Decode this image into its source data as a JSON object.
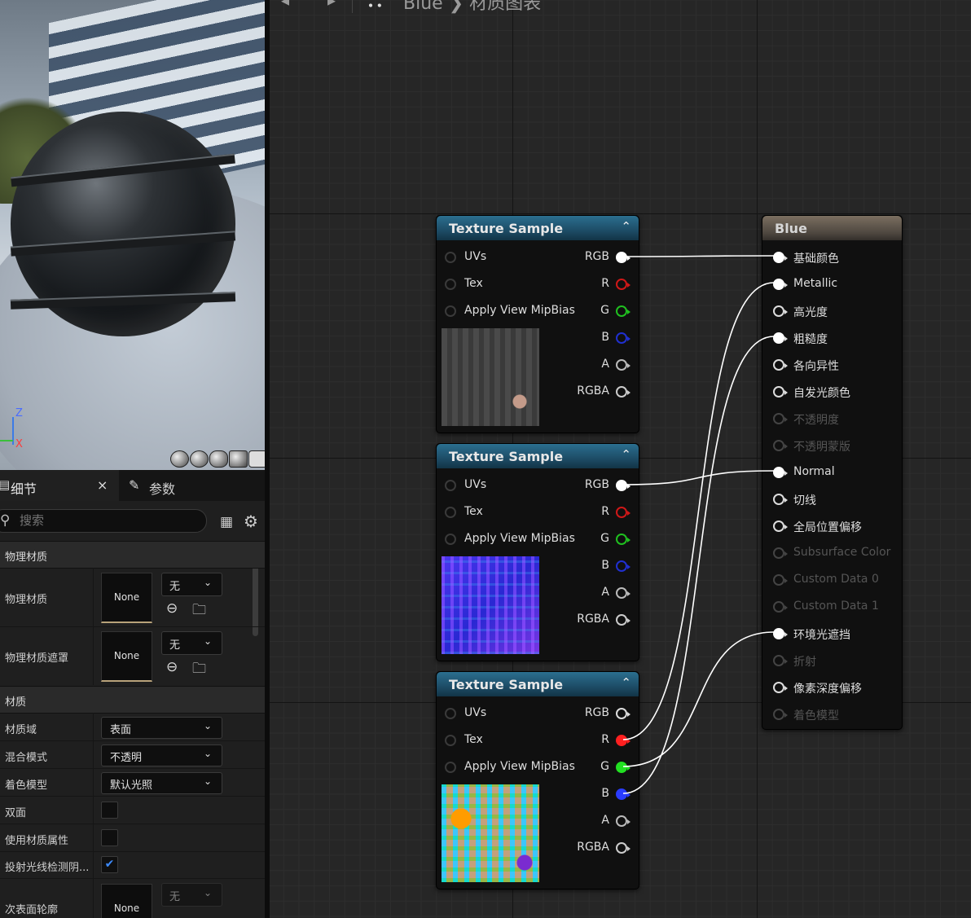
{
  "viewport": {
    "axis_z": "Z",
    "axis_x": "X",
    "shape_buttons": [
      "cylinder-preview-icon",
      "sphere-preview-icon",
      "plane-preview-icon",
      "cube-preview-icon",
      "custom-mesh-preview-icon"
    ]
  },
  "details": {
    "tabs": [
      {
        "label": "细节",
        "close": "×"
      },
      {
        "label": "参数"
      }
    ],
    "search": {
      "placeholder": "搜索"
    },
    "sections": {
      "physical_material": "物理材质",
      "material": "材质"
    },
    "props": {
      "phys_mat_label": "物理材质",
      "phys_mat_value": "None",
      "phys_mat_combo": "无",
      "phys_mat_mask_label": "物理材质遮罩",
      "phys_mat_mask_value": "None",
      "phys_mat_mask_combo": "无",
      "material_domain_label": "材质域",
      "material_domain_value": "表面",
      "blend_mode_label": "混合模式",
      "blend_mode_value": "不透明",
      "shading_model_label": "着色模型",
      "shading_model_value": "默认光照",
      "two_sided_label": "双面",
      "use_mat_attr_label": "使用材质属性",
      "cast_ray_label": "投射光线检测阴...",
      "cast_ray_checked": "✔",
      "subsurface_label": "次表面轮廓",
      "subsurface_value": "None",
      "subsurface_combo": "无"
    }
  },
  "graph": {
    "breadcrumb": {
      "back": "◂",
      "forward": "▸",
      "asset": "Blue",
      "separator": "❯",
      "page": "材质图表"
    },
    "texture_nodes": [
      {
        "title": "Texture Sample",
        "inputs": [
          "UVs",
          "Tex",
          "Apply View MipBias"
        ],
        "outputs": [
          "RGB",
          "R",
          "G",
          "B",
          "A",
          "RGBA"
        ],
        "preview": "grunge"
      },
      {
        "title": "Texture Sample",
        "inputs": [
          "UVs",
          "Tex",
          "Apply View MipBias"
        ],
        "outputs": [
          "RGB",
          "R",
          "G",
          "B",
          "A",
          "RGBA"
        ],
        "preview": "normal"
      },
      {
        "title": "Texture Sample",
        "inputs": [
          "UVs",
          "Tex",
          "Apply View MipBias"
        ],
        "outputs": [
          "RGB",
          "R",
          "G",
          "B",
          "A",
          "RGBA"
        ],
        "preview": "orm"
      }
    ],
    "material_node": {
      "title": "Blue",
      "pins": [
        {
          "label": "基础颜色",
          "state": "connected"
        },
        {
          "label": "Metallic",
          "state": "connected"
        },
        {
          "label": "高光度",
          "state": "enabled"
        },
        {
          "label": "粗糙度",
          "state": "connected"
        },
        {
          "label": "各向异性",
          "state": "enabled"
        },
        {
          "label": "自发光颜色",
          "state": "enabled"
        },
        {
          "label": "不透明度",
          "state": "disabled"
        },
        {
          "label": "不透明蒙版",
          "state": "disabled"
        },
        {
          "label": "Normal",
          "state": "connected"
        },
        {
          "label": "切线",
          "state": "enabled"
        },
        {
          "label": "全局位置偏移",
          "state": "enabled"
        },
        {
          "label": "Subsurface Color",
          "state": "disabled"
        },
        {
          "label": "Custom Data 0",
          "state": "disabled"
        },
        {
          "label": "Custom Data 1",
          "state": "disabled"
        },
        {
          "label": "环境光遮挡",
          "state": "connected"
        },
        {
          "label": "折射",
          "state": "disabled"
        },
        {
          "label": "像素深度偏移",
          "state": "enabled"
        },
        {
          "label": "着色模型",
          "state": "disabled"
        }
      ]
    },
    "colors": {
      "r": "#ff2020",
      "g": "#22e022",
      "b": "#2a3cff",
      "wire": "#ffffff"
    }
  }
}
